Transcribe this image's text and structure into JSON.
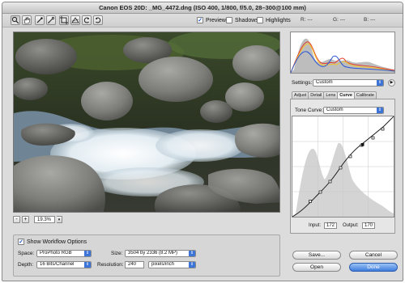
{
  "window": {
    "title": "Canon EOS 20D: _MG_4472.dng (ISO 400, 1/800, f/5.0, 28–300@100 mm)"
  },
  "toolbar": {
    "tools": [
      "zoom-tool",
      "hand-tool",
      "white-balance-tool",
      "color-sampler-tool",
      "crop-tool",
      "straighten-tool",
      "rotate-left-tool",
      "rotate-right-tool"
    ],
    "preview_label": "Preview",
    "preview_checked": true,
    "shadows_label": "Shadows",
    "shadows_checked": false,
    "highlights_label": "Highlights",
    "highlights_checked": false,
    "r_label": "R:",
    "g_label": "G:",
    "b_label": "B:",
    "r_value": "---",
    "g_value": "---",
    "b_value": "---"
  },
  "zoom": {
    "minus": "-",
    "plus": "+",
    "value": "19.3%"
  },
  "workflow": {
    "show_label": "Show Workflow Options",
    "show_checked": true,
    "space_label": "Space:",
    "space_value": "ProPhoto RGB",
    "depth_label": "Depth:",
    "depth_value": "16 Bits/Channel",
    "size_label": "Size:",
    "size_value": "3504 by 2336 (8.2 MP)",
    "resolution_label": "Resolution:",
    "resolution_value": "240",
    "resolution_unit": "pixels/inch"
  },
  "panel": {
    "settings_label": "Settings:",
    "settings_value": "Custom",
    "tabs": [
      "Adjust",
      "Detail",
      "Lens",
      "Curve",
      "Calibrate"
    ],
    "active_tab": "Curve",
    "tone_curve_label": "Tone Curve:",
    "tone_curve_value": "Custom",
    "input_label": "Input:",
    "input_value": "172",
    "output_label": "Output:",
    "output_value": "170"
  },
  "buttons": {
    "save": "Save...",
    "cancel": "Cancel",
    "open": "Open",
    "done": "Done"
  },
  "colors": {
    "accent": "#3f7ddd",
    "histogram_red": "#e23b2a",
    "histogram_yellow": "#f2c52b",
    "histogram_blue": "#2a55d6"
  }
}
